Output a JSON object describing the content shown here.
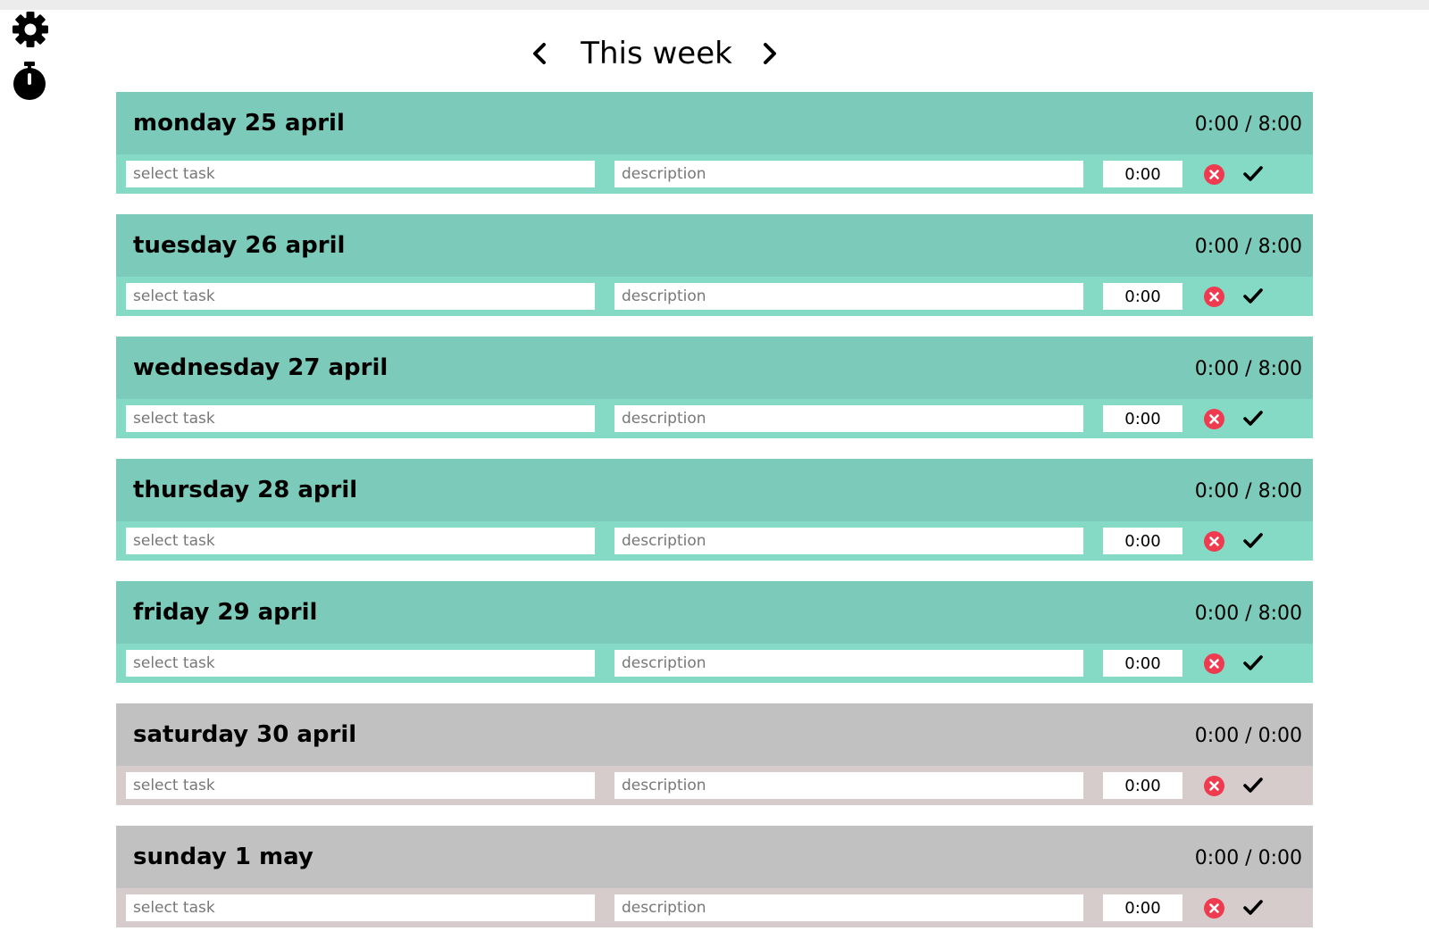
{
  "sidebar": {
    "settings_icon": "gear-icon",
    "timer_icon": "stopwatch-icon"
  },
  "header": {
    "title": "This week",
    "prev_icon": "chevron-left-icon",
    "next_icon": "chevron-right-icon"
  },
  "colors": {
    "weekday_header": "#7ccab9",
    "weekday_row": "#85dac6",
    "weekend_header": "#c1c1c1",
    "weekend_row": "#d6cccb",
    "cancel_icon": "#ef3b4f"
  },
  "days": [
    {
      "title": "monday 25 april",
      "total": "0:00 / 8:00",
      "kind": "weekday",
      "task_placeholder": "select task",
      "description_placeholder": "description",
      "time": "0:00"
    },
    {
      "title": "tuesday 26 april",
      "total": "0:00 / 8:00",
      "kind": "weekday",
      "task_placeholder": "select task",
      "description_placeholder": "description",
      "time": "0:00"
    },
    {
      "title": "wednesday 27 april",
      "total": "0:00 / 8:00",
      "kind": "weekday",
      "task_placeholder": "select task",
      "description_placeholder": "description",
      "time": "0:00"
    },
    {
      "title": "thursday 28 april",
      "total": "0:00 / 8:00",
      "kind": "weekday",
      "task_placeholder": "select task",
      "description_placeholder": "description",
      "time": "0:00"
    },
    {
      "title": "friday 29 april",
      "total": "0:00 / 8:00",
      "kind": "weekday",
      "task_placeholder": "select task",
      "description_placeholder": "description",
      "time": "0:00"
    },
    {
      "title": "saturday 30 april",
      "total": "0:00 / 0:00",
      "kind": "weekend",
      "task_placeholder": "select task",
      "description_placeholder": "description",
      "time": "0:00"
    },
    {
      "title": "sunday 1 may",
      "total": "0:00 / 0:00",
      "kind": "weekend",
      "task_placeholder": "select task",
      "description_placeholder": "description",
      "time": "0:00"
    }
  ]
}
